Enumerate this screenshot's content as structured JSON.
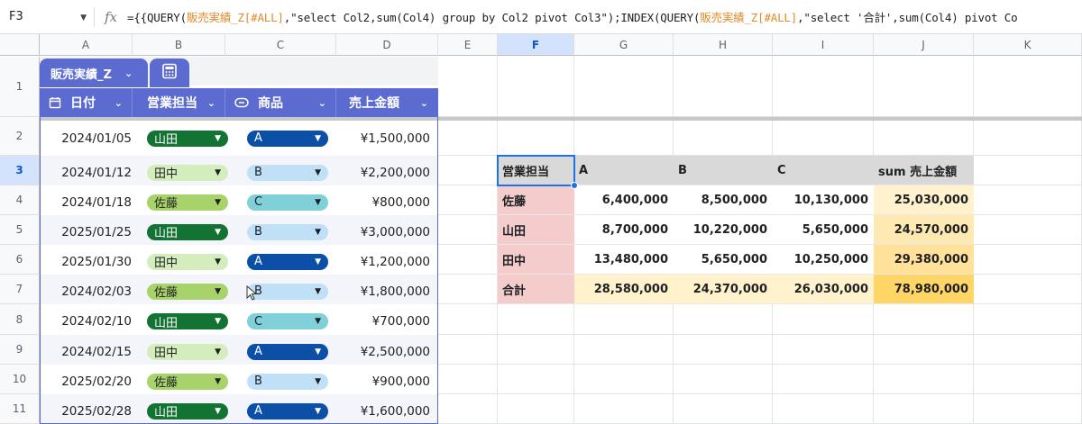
{
  "formula_bar": {
    "cell_ref": "F3",
    "fx_label": "fx",
    "formula_parts": [
      {
        "text": "={{QUERY(",
        "c": ""
      },
      {
        "text": "販売実績_Z[#ALL]",
        "c": "o"
      },
      {
        "text": ",\"select Col2,sum(Col4) group by Col2 pivot Col3\");INDEX(QUERY(",
        "c": ""
      },
      {
        "text": "販売実績_Z[#ALL]",
        "c": "o"
      },
      {
        "text": ",\"select '合計',sum(Col4) pivot Co",
        "c": ""
      }
    ]
  },
  "columns": [
    "A",
    "B",
    "C",
    "D",
    "E",
    "F",
    "G",
    "H",
    "I",
    "J",
    "K"
  ],
  "rows": [
    "1",
    "2",
    "3",
    "4",
    "5",
    "6",
    "7",
    "8",
    "9",
    "10",
    "11"
  ],
  "selected": {
    "col": "F",
    "row": "3"
  },
  "table": {
    "name": "販売実績_Z",
    "headers": [
      "日付",
      "営業担当",
      "商品",
      "売上金額"
    ],
    "header_icons": [
      "calendar-icon",
      "",
      "dropdown-chip-icon",
      ""
    ],
    "rows": [
      {
        "date": "2024/01/05",
        "rep": "山田",
        "product": "A",
        "amount": "¥1,500,000"
      },
      {
        "date": "2024/01/12",
        "rep": "田中",
        "product": "B",
        "amount": "¥2,200,000"
      },
      {
        "date": "2024/01/18",
        "rep": "佐藤",
        "product": "C",
        "amount": "¥800,000"
      },
      {
        "date": "2025/01/25",
        "rep": "山田",
        "product": "B",
        "amount": "¥3,000,000"
      },
      {
        "date": "2025/01/30",
        "rep": "田中",
        "product": "A",
        "amount": "¥1,200,000"
      },
      {
        "date": "2024/02/03",
        "rep": "佐藤",
        "product": "B",
        "amount": "¥1,800,000"
      },
      {
        "date": "2024/02/10",
        "rep": "山田",
        "product": "C",
        "amount": "¥700,000"
      },
      {
        "date": "2024/02/15",
        "rep": "田中",
        "product": "A",
        "amount": "¥2,500,000"
      },
      {
        "date": "2025/02/20",
        "rep": "佐藤",
        "product": "B",
        "amount": "¥900,000"
      },
      {
        "date": "2025/02/28",
        "rep": "山田",
        "product": "A",
        "amount": "¥1,600,000"
      }
    ]
  },
  "chip_colors": {
    "山田": {
      "bg": "#137333",
      "fg": "#ffffff"
    },
    "田中": {
      "bg": "#d4edbc",
      "fg": "#202124"
    },
    "佐藤": {
      "bg": "#a8d26a",
      "fg": "#202124"
    },
    "A": {
      "bg": "#0b4fa6",
      "fg": "#ffffff"
    },
    "B": {
      "bg": "#bfe0f6",
      "fg": "#202124"
    },
    "C": {
      "bg": "#7fd0d8",
      "fg": "#202124"
    }
  },
  "pivot": {
    "header": [
      "営業担当",
      "A",
      "B",
      "C",
      "sum 売上金額"
    ],
    "rows": [
      [
        "佐藤",
        "6,400,000",
        "8,500,000",
        "10,130,000",
        "25,030,000"
      ],
      [
        "山田",
        "8,700,000",
        "10,220,000",
        "5,650,000",
        "24,570,000"
      ],
      [
        "田中",
        "13,480,000",
        "5,650,000",
        "10,250,000",
        "29,380,000"
      ],
      [
        "合計",
        "28,580,000",
        "24,370,000",
        "26,030,000",
        "78,980,000"
      ]
    ],
    "colors": {
      "header_bg": "#d9d9d9",
      "rep_bg": "#f4cccc",
      "total_row_bg": "#fff2cc",
      "total_col": [
        "#fff2cc",
        "#ffe9b3",
        "#ffe199",
        "#ffd666"
      ]
    }
  }
}
